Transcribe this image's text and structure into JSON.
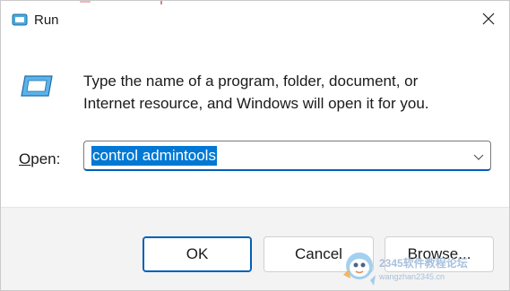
{
  "window": {
    "title": "Run",
    "close_icon": "close-icon",
    "title_icon": "run-icon"
  },
  "content": {
    "icon": "run-app-icon",
    "description_line1": "Type the name of a program, folder, document, or",
    "description_line2": "Internet resource, and Windows will open it for you."
  },
  "open": {
    "label_accel": "O",
    "label_rest": "pen:",
    "value": "control admintools",
    "dropdown_icon": "chevron-down-icon"
  },
  "buttons": {
    "ok": "OK",
    "cancel": "Cancel",
    "browse": "Browse..."
  },
  "watermark": {
    "line1": "2345软件教程论坛",
    "line2": "wangzhan2345.cn"
  },
  "colors": {
    "accent": "#005fb8",
    "selection": "#0078d4",
    "footer_bg": "#f3f3f3"
  }
}
